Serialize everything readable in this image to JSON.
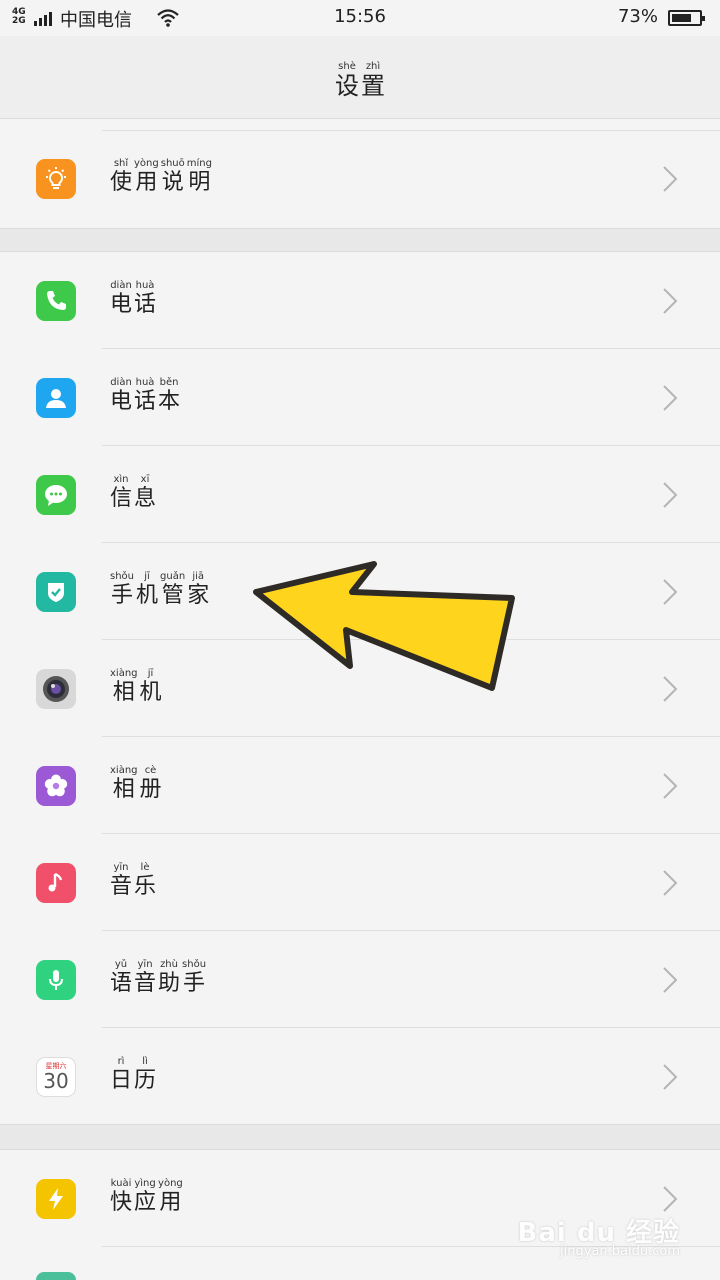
{
  "status_bar": {
    "network_top": "4G",
    "network_bottom": "2G",
    "carrier": "中国电信",
    "time": "15:56",
    "battery_percent_label": "73%",
    "battery_level": 0.73
  },
  "header": {
    "title_chars": [
      {
        "py": "shè",
        "hz": "设"
      },
      {
        "py": "zhì",
        "hz": "置"
      }
    ]
  },
  "groups": [
    {
      "items": [
        {
          "name": "manual",
          "icon": "lightbulb-icon",
          "color": "#f7931e",
          "chars": [
            {
              "py": "shǐ",
              "hz": "使"
            },
            {
              "py": "yòng",
              "hz": "用"
            },
            {
              "py": "shuō",
              "hz": "说"
            },
            {
              "py": "míng",
              "hz": "明"
            }
          ]
        }
      ]
    },
    {
      "items": [
        {
          "name": "phone",
          "icon": "phone-icon",
          "color": "#3ec94a",
          "chars": [
            {
              "py": "diàn",
              "hz": "电"
            },
            {
              "py": "huà",
              "hz": "话"
            }
          ]
        },
        {
          "name": "contacts",
          "icon": "contacts-icon",
          "color": "#1ea7f0",
          "chars": [
            {
              "py": "diàn",
              "hz": "电"
            },
            {
              "py": "huà",
              "hz": "话"
            },
            {
              "py": "běn",
              "hz": "本"
            }
          ]
        },
        {
          "name": "messages",
          "icon": "message-icon",
          "color": "#3ec94a",
          "chars": [
            {
              "py": "xìn",
              "hz": "信"
            },
            {
              "py": "xī",
              "hz": "息"
            }
          ]
        },
        {
          "name": "phone-manager",
          "icon": "shield-icon",
          "color": "#22b8a2",
          "chars": [
            {
              "py": "shǒu",
              "hz": "手"
            },
            {
              "py": "jī",
              "hz": "机"
            },
            {
              "py": "guǎn",
              "hz": "管"
            },
            {
              "py": "jiā",
              "hz": "家"
            }
          ]
        },
        {
          "name": "camera",
          "icon": "camera-icon",
          "color": "#d8d8d8",
          "chars": [
            {
              "py": "xiàng",
              "hz": "相"
            },
            {
              "py": "jī",
              "hz": "机"
            }
          ]
        },
        {
          "name": "album",
          "icon": "flower-icon",
          "color": "#9b59d6",
          "chars": [
            {
              "py": "xiàng",
              "hz": "相"
            },
            {
              "py": "cè",
              "hz": "册"
            }
          ]
        },
        {
          "name": "music",
          "icon": "music-note-icon",
          "color": "#f0506a",
          "chars": [
            {
              "py": "yīn",
              "hz": "音"
            },
            {
              "py": "lè",
              "hz": "乐"
            }
          ]
        },
        {
          "name": "voice-assistant",
          "icon": "microphone-icon",
          "color": "#2fd37f",
          "chars": [
            {
              "py": "yǔ",
              "hz": "语"
            },
            {
              "py": "yīn",
              "hz": "音"
            },
            {
              "py": "zhù",
              "hz": "助"
            },
            {
              "py": "shǒu",
              "hz": "手"
            }
          ]
        },
        {
          "name": "calendar",
          "icon": "calendar-icon",
          "color": "#ffffff",
          "calendar_weekday": "星期六",
          "calendar_day": "30",
          "chars": [
            {
              "py": "rì",
              "hz": "日"
            },
            {
              "py": "lì",
              "hz": "历"
            }
          ]
        }
      ]
    },
    {
      "items": [
        {
          "name": "quick-app",
          "icon": "lightning-icon",
          "color": "#f5c400",
          "chars": [
            {
              "py": "kuài",
              "hz": "快"
            },
            {
              "py": "yìng",
              "hz": "应"
            },
            {
              "py": "yòng",
              "hz": "用"
            }
          ]
        }
      ]
    }
  ],
  "watermark": {
    "brand": "Bai du 经验",
    "url": "jingyan.baidu.com"
  }
}
